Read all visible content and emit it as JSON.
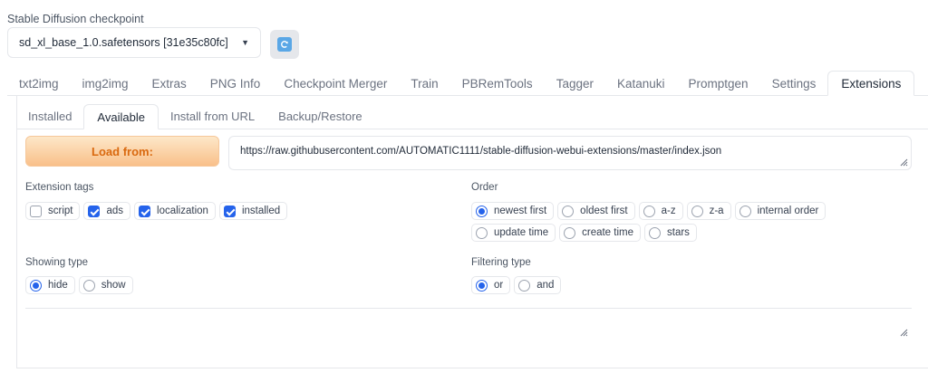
{
  "checkpoint": {
    "label": "Stable Diffusion checkpoint",
    "value": "sd_xl_base_1.0.safetensors [31e35c80fc]",
    "refresh_icon": "refresh-icon"
  },
  "main_tabs": [
    {
      "label": "txt2img",
      "active": false
    },
    {
      "label": "img2img",
      "active": false
    },
    {
      "label": "Extras",
      "active": false
    },
    {
      "label": "PNG Info",
      "active": false
    },
    {
      "label": "Checkpoint Merger",
      "active": false
    },
    {
      "label": "Train",
      "active": false
    },
    {
      "label": "PBRemTools",
      "active": false
    },
    {
      "label": "Tagger",
      "active": false
    },
    {
      "label": "Katanuki",
      "active": false
    },
    {
      "label": "Promptgen",
      "active": false
    },
    {
      "label": "Settings",
      "active": false
    },
    {
      "label": "Extensions",
      "active": true
    }
  ],
  "sub_tabs": [
    {
      "label": "Installed",
      "active": false
    },
    {
      "label": "Available",
      "active": true
    },
    {
      "label": "Install from URL",
      "active": false
    },
    {
      "label": "Backup/Restore",
      "active": false
    }
  ],
  "load_button": "Load from:",
  "url": "https://raw.githubusercontent.com/AUTOMATIC1111/stable-diffusion-webui-extensions/master/index.json",
  "extension_tags": {
    "label": "Extension tags",
    "options": [
      {
        "label": "script",
        "checked": false
      },
      {
        "label": "ads",
        "checked": true
      },
      {
        "label": "localization",
        "checked": true
      },
      {
        "label": "installed",
        "checked": true
      }
    ]
  },
  "order": {
    "label": "Order",
    "options": [
      {
        "label": "newest first",
        "selected": true
      },
      {
        "label": "oldest first",
        "selected": false
      },
      {
        "label": "a-z",
        "selected": false
      },
      {
        "label": "z-a",
        "selected": false
      },
      {
        "label": "internal order",
        "selected": false
      },
      {
        "label": "update time",
        "selected": false
      },
      {
        "label": "create time",
        "selected": false
      },
      {
        "label": "stars",
        "selected": false
      }
    ]
  },
  "showing_type": {
    "label": "Showing type",
    "options": [
      {
        "label": "hide",
        "selected": true
      },
      {
        "label": "show",
        "selected": false
      }
    ]
  },
  "filtering_type": {
    "label": "Filtering type",
    "options": [
      {
        "label": "or",
        "selected": true
      },
      {
        "label": "and",
        "selected": false
      }
    ]
  },
  "colors": {
    "accent": "#2563eb",
    "load_button_text": "#d9690f",
    "border": "#e5e7eb"
  }
}
